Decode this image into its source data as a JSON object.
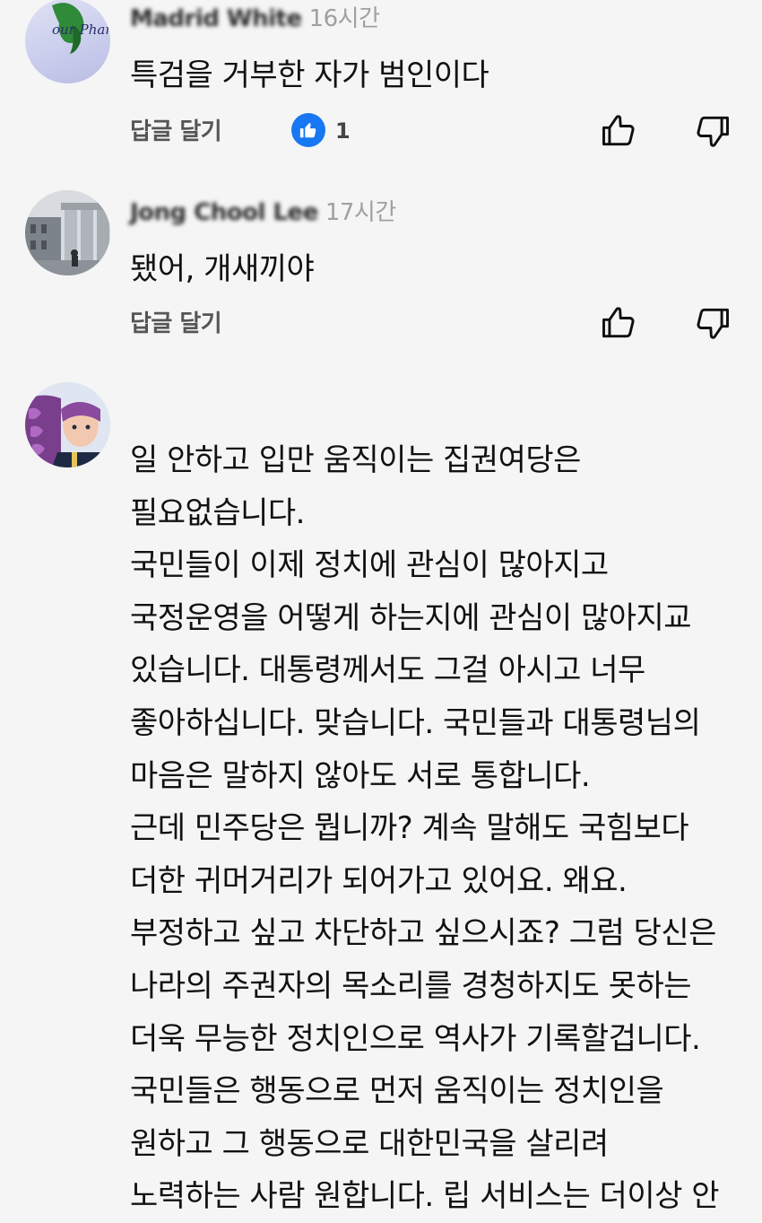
{
  "comments": [
    {
      "author": "Madrid White",
      "time": "16시간",
      "avatar_caption": "our Phantoms",
      "text": "특검을 거부한 자가 범인이다",
      "reply_label": "답글 달기",
      "like_count": "1"
    },
    {
      "author": "Jong Chool Lee",
      "time": "17시간",
      "text": "됐어, 개새끼야",
      "reply_label": "답글 달기"
    },
    {
      "author": "",
      "time": "",
      "lines": [
        "일 안하고 입만 움직이는 집권여당은",
        "필요없습니다.",
        "국민들이 이제 정치에 관심이 많아지고",
        "국정운영을 어떻게 하는지에 관심이 많아지교",
        "있습니다. 대통령께서도 그걸 아시고 너무",
        "좋아하십니다. 맞습니다. 국민들과 대통령님의",
        "마음은 말하지 않아도 서로 통합니다.",
        "근데 민주당은 뭡니까? 계속 말해도 국힘보다",
        "더한 귀머거리가 되어가고 있어요. 왜요.",
        "부정하고 싶고 차단하고 싶으시죠? 그럼 당신은",
        "나라의 주권자의 목소리를 경청하지도 못하는",
        "더욱 무능한 정치인으로 역사가 기록할겁니다.",
        "국민들은 행동으로 먼저 움직이는 정치인을",
        "원하고 그 행동으로 대한민국을 살리려",
        "노력하는 사람 원합니다. 립 서비스는 더이상 안"
      ]
    }
  ],
  "colors": {
    "background": "#f5f5f5",
    "like_badge": "#1877f2",
    "meta_text": "#a0a0a0",
    "reply_text": "#555555"
  },
  "icons": [
    "thumbs-up-icon",
    "thumbs-down-icon",
    "like-badge-icon"
  ]
}
